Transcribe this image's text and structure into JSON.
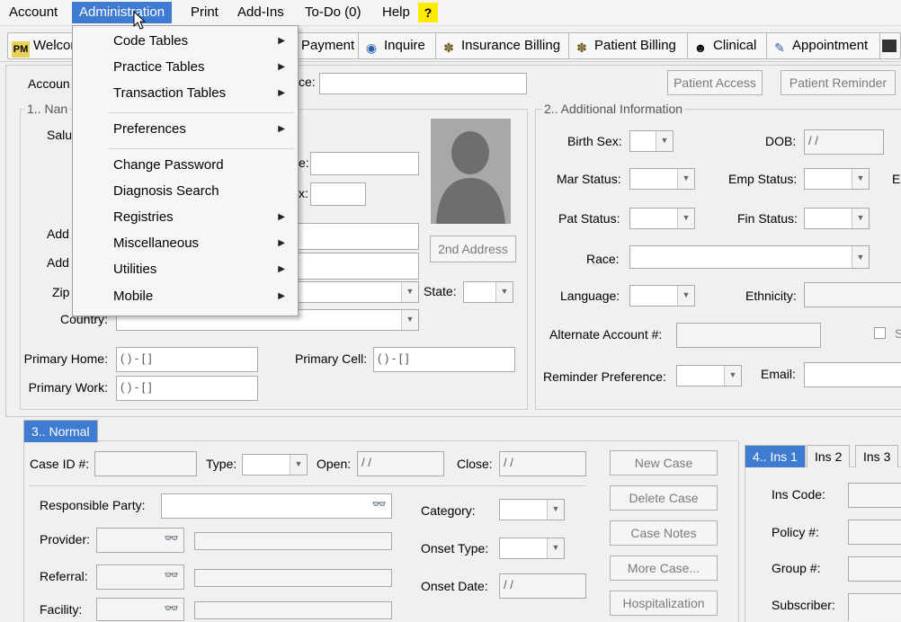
{
  "menubar": {
    "items": [
      "Account",
      "Administration",
      "Print",
      "Add-Ins",
      "To-Do (0)",
      "Help"
    ],
    "help_badge": "?"
  },
  "toolbar": {
    "buttons": [
      "Welcome",
      "Payment",
      "Inquire",
      "Insurance Billing",
      "Patient Billing",
      "Clinical",
      "Appointment"
    ]
  },
  "admin_menu": {
    "items": [
      {
        "label": "Code Tables",
        "submenu": true
      },
      {
        "label": "Practice Tables",
        "submenu": true
      },
      {
        "label": "Transaction Tables",
        "submenu": true
      },
      {
        "label": "Preferences",
        "submenu": true
      },
      {
        "label": "Change Password",
        "submenu": false
      },
      {
        "label": "Diagnosis Search",
        "submenu": false
      },
      {
        "label": "Registries",
        "submenu": true
      },
      {
        "label": "Miscellaneous",
        "submenu": true
      },
      {
        "label": "Utilities",
        "submenu": true
      },
      {
        "label": "Mobile",
        "submenu": true
      }
    ]
  },
  "top": {
    "account_label": "Accoun",
    "ice_label": "ce:",
    "patient_access": "Patient Access",
    "patient_reminder": "Patient Reminder"
  },
  "section1": {
    "legend": "1.. Nan",
    "salutation": "Salu",
    "e_label": "e:",
    "x_label": "x:",
    "addr1": "Add",
    "addr2": "Add",
    "zip": "Zip",
    "state": "State:",
    "country": "Country:",
    "second_address": "2nd Address",
    "primary_home": "Primary Home:",
    "primary_home_val": "( )  -  [   ]",
    "primary_cell": "Primary Cell:",
    "primary_cell_val": "( )  -  [   ]",
    "primary_work": "Primary Work:",
    "primary_work_val": "( )  -  [   ]"
  },
  "section2": {
    "legend": "2.. Additional Information",
    "birth_sex": "Birth Sex:",
    "dob": "DOB:",
    "dob_val": " / /",
    "mar_status": "Mar Status:",
    "emp_status": "Emp Status:",
    "e_cut": "E",
    "pat_status": "Pat Status:",
    "fin_status": "Fin Status:",
    "race": "Race:",
    "language": "Language:",
    "ethnicity": "Ethnicity:",
    "alt_account": "Alternate Account #:",
    "s_cut": "S",
    "reminder_pref": "Reminder Preference:",
    "email": "Email:"
  },
  "section3": {
    "tab": "3.. Normal",
    "case_id": "Case ID #:",
    "type": "Type:",
    "open": "Open:",
    "open_val": " / /",
    "close": "Close:",
    "close_val": " / /",
    "responsible_party": "Responsible Party:",
    "provider": "Provider:",
    "referral": "Referral:",
    "facility": "Facility:",
    "category": "Category:",
    "onset_type": "Onset Type:",
    "onset_date": "Onset Date:",
    "onset_date_val": " / /",
    "buttons": [
      "New Case",
      "Delete Case",
      "Case Notes",
      "More Case...",
      "Hospitalization"
    ]
  },
  "section4": {
    "tabs": [
      "4.. Ins 1",
      "Ins 2",
      "Ins 3"
    ],
    "ins_code": "Ins Code:",
    "policy": "Policy #:",
    "group": "Group #:",
    "subscriber": "Subscriber:"
  },
  "colors": {
    "accent": "#3e7bd1",
    "help_badge": "#ffea00"
  }
}
